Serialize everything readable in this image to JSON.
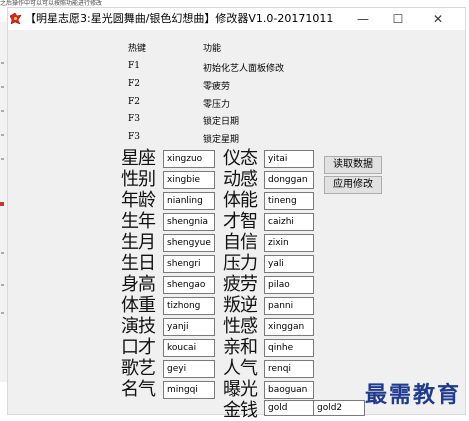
{
  "caption": "之后操作中可以可以按照功能进行修改",
  "window": {
    "title": "【明星志愿3:星光圆舞曲/银色幻想曲】修改器V1.0-20171011",
    "minimize": "—",
    "maximize": "☐",
    "close": "✕"
  },
  "hotkeys": {
    "header_key": "热键",
    "header_func": "功能",
    "rows": [
      {
        "key": "F1",
        "func": "初始化艺人面板修改"
      },
      {
        "key": "F2",
        "func": "零疲劳"
      },
      {
        "key": "F2",
        "func": "零压力"
      },
      {
        "key": "F3",
        "func": "锁定日期"
      },
      {
        "key": "F3",
        "func": "锁定星期"
      }
    ]
  },
  "fields_left": [
    {
      "label": "星座",
      "value": "xingzuo"
    },
    {
      "label": "性别",
      "value": "xingbie"
    },
    {
      "label": "年龄",
      "value": "nianling"
    },
    {
      "label": "生年",
      "value": "shengnia"
    },
    {
      "label": "生月",
      "value": "shengyue"
    },
    {
      "label": "生日",
      "value": "shengri"
    },
    {
      "label": "身高",
      "value": "shengao"
    },
    {
      "label": "体重",
      "value": "tizhong"
    },
    {
      "label": "演技",
      "value": "yanji"
    },
    {
      "label": "口才",
      "value": "koucai"
    },
    {
      "label": "歌艺",
      "value": "geyi"
    },
    {
      "label": "名气",
      "value": "mingqi"
    }
  ],
  "fields_right": [
    {
      "label": "仪态",
      "value": "yitai"
    },
    {
      "label": "动感",
      "value": "donggan"
    },
    {
      "label": "体能",
      "value": "tineng"
    },
    {
      "label": "才智",
      "value": "caizhi"
    },
    {
      "label": "自信",
      "value": "zixin"
    },
    {
      "label": "压力",
      "value": "yali"
    },
    {
      "label": "疲劳",
      "value": "pilao"
    },
    {
      "label": "叛逆",
      "value": "panni"
    },
    {
      "label": "性感",
      "value": "xinggan"
    },
    {
      "label": "亲和",
      "value": "qinhe"
    },
    {
      "label": "人气",
      "value": "renqi"
    },
    {
      "label": "曝光",
      "value": "baoguan"
    },
    {
      "label": "金钱",
      "value": "gold"
    }
  ],
  "extra_field": "gold2",
  "buttons": {
    "read": "读取数据",
    "apply": "应用修改"
  },
  "watermark": "最需教育"
}
